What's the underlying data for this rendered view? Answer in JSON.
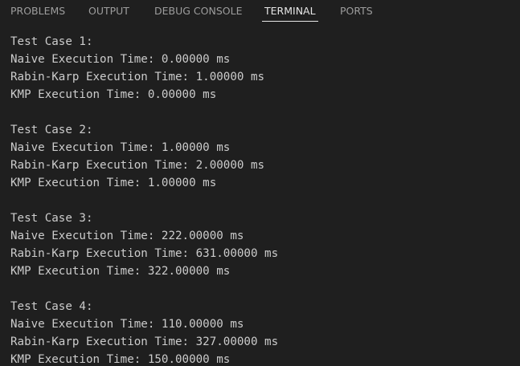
{
  "tabs": [
    {
      "label": "PROBLEMS"
    },
    {
      "label": "OUTPUT"
    },
    {
      "label": "DEBUG CONSOLE"
    },
    {
      "label": "TERMINAL",
      "active": true
    },
    {
      "label": "PORTS"
    }
  ],
  "terminal": {
    "lines": [
      "Test Case 1:",
      "Naive Execution Time: 0.00000 ms",
      "Rabin-Karp Execution Time: 1.00000 ms",
      "KMP Execution Time: 0.00000 ms",
      "",
      "Test Case 2:",
      "Naive Execution Time: 1.00000 ms",
      "Rabin-Karp Execution Time: 2.00000 ms",
      "KMP Execution Time: 1.00000 ms",
      "",
      "Test Case 3:",
      "Naive Execution Time: 222.00000 ms",
      "Rabin-Karp Execution Time: 631.00000 ms",
      "KMP Execution Time: 322.00000 ms",
      "",
      "Test Case 4:",
      "Naive Execution Time: 110.00000 ms",
      "Rabin-Karp Execution Time: 327.00000 ms",
      "KMP Execution Time: 150.00000 ms"
    ]
  }
}
